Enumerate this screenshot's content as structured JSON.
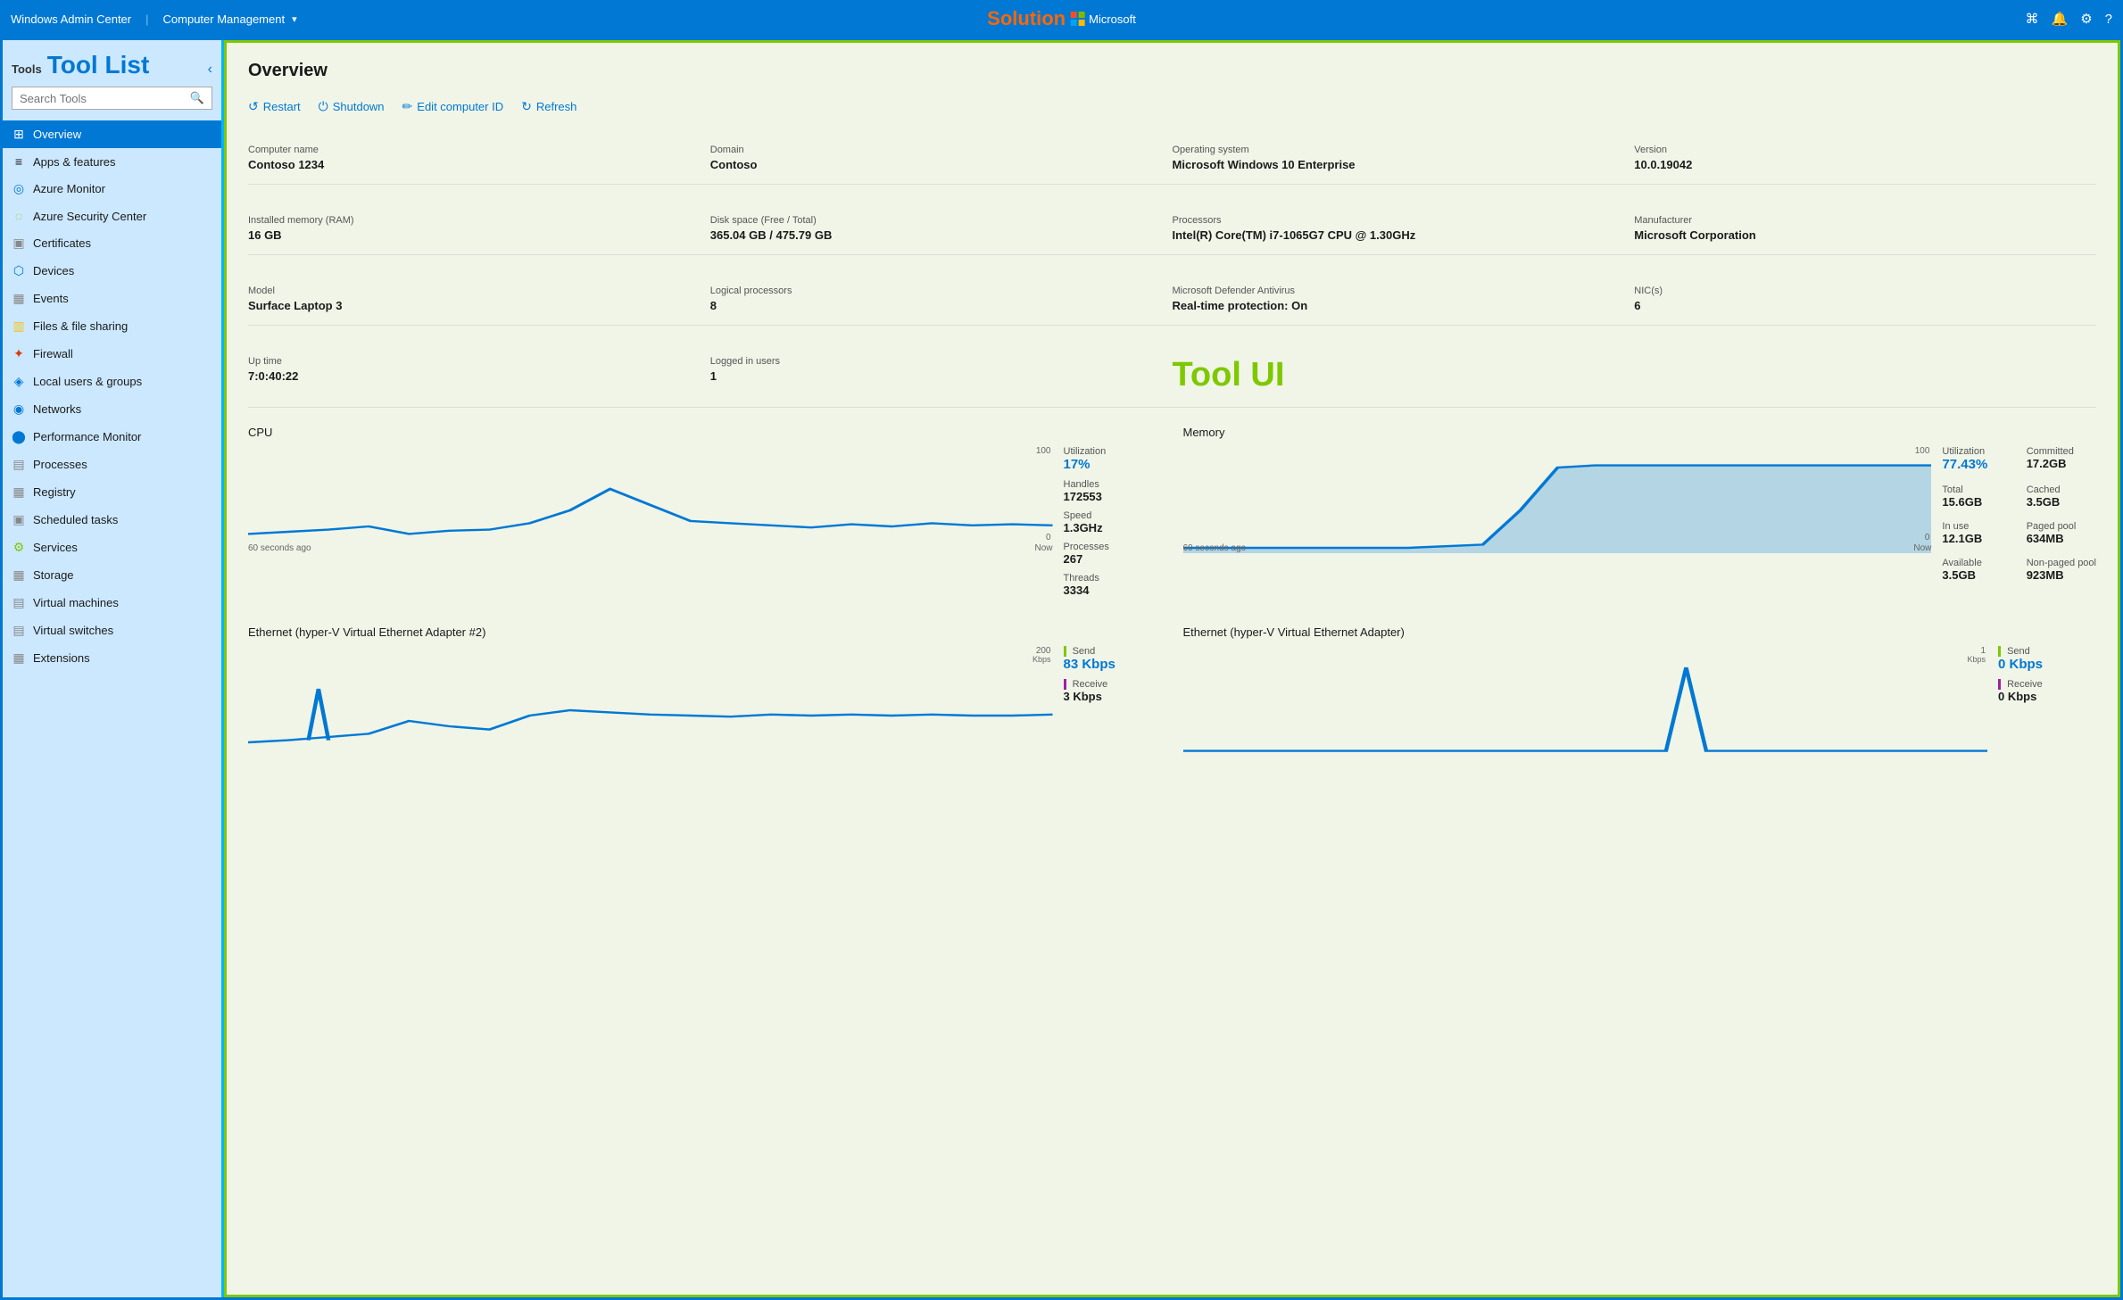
{
  "topbar": {
    "app_title": "Windows Admin Center",
    "context": "Computer Management",
    "solution_label": "Solution",
    "microsoft_label": "Microsoft",
    "icons": [
      "terminal-icon",
      "bell-icon",
      "gear-icon",
      "help-icon"
    ]
  },
  "sidebar": {
    "tools_small": "Tools",
    "title": "Tool List",
    "collapse_icon": "‹",
    "search_placeholder": "Search Tools",
    "items": [
      {
        "id": "overview",
        "label": "Overview",
        "icon": "⊞",
        "active": true
      },
      {
        "id": "apps",
        "label": "Apps & features",
        "icon": "≡"
      },
      {
        "id": "azure-monitor",
        "label": "Azure Monitor",
        "icon": "◎"
      },
      {
        "id": "azure-security",
        "label": "Azure Security Center",
        "icon": "○"
      },
      {
        "id": "certificates",
        "label": "Certificates",
        "icon": "▣"
      },
      {
        "id": "devices",
        "label": "Devices",
        "icon": "⬡"
      },
      {
        "id": "events",
        "label": "Events",
        "icon": "▦"
      },
      {
        "id": "files",
        "label": "Files & file sharing",
        "icon": "▥"
      },
      {
        "id": "firewall",
        "label": "Firewall",
        "icon": "✦"
      },
      {
        "id": "local-users",
        "label": "Local users & groups",
        "icon": "◈"
      },
      {
        "id": "networks",
        "label": "Networks",
        "icon": "◉"
      },
      {
        "id": "perf-monitor",
        "label": "Performance Monitor",
        "icon": "⬤"
      },
      {
        "id": "processes",
        "label": "Processes",
        "icon": "▤"
      },
      {
        "id": "registry",
        "label": "Registry",
        "icon": "▦"
      },
      {
        "id": "scheduled",
        "label": "Scheduled tasks",
        "icon": "▣"
      },
      {
        "id": "services",
        "label": "Services",
        "icon": "⚙"
      },
      {
        "id": "storage",
        "label": "Storage",
        "icon": "▦"
      },
      {
        "id": "vm",
        "label": "Virtual machines",
        "icon": "▤"
      },
      {
        "id": "vswitches",
        "label": "Virtual switches",
        "icon": "▤"
      },
      {
        "id": "extensions",
        "label": "Extensions",
        "icon": "▦"
      }
    ]
  },
  "overview": {
    "title": "Overview",
    "toolbar": {
      "restart": "Restart",
      "shutdown": "Shutdown",
      "edit_id": "Edit computer ID",
      "refresh": "Refresh"
    },
    "tool_ui_label": "Tool UI",
    "info": {
      "computer_name_label": "Computer name",
      "computer_name": "Contoso 1234",
      "domain_label": "Domain",
      "domain": "Contoso",
      "os_label": "Operating system",
      "os": "Microsoft Windows 10 Enterprise",
      "version_label": "Version",
      "version": "10.0.19042",
      "ram_label": "Installed memory (RAM)",
      "ram": "16 GB",
      "disk_label": "Disk space (Free / Total)",
      "disk": "365.04 GB / 475.79 GB",
      "processors_label": "Processors",
      "processors": "Intel(R) Core(TM) i7-1065G7 CPU @ 1.30GHz",
      "manufacturer_label": "Manufacturer",
      "manufacturer": "Microsoft Corporation",
      "model_label": "Model",
      "model": "Surface Laptop 3",
      "logical_proc_label": "Logical processors",
      "logical_proc": "8",
      "defender_label": "Microsoft Defender Antivirus",
      "defender": "Real-time protection: On",
      "nics_label": "NIC(s)",
      "nics": "6",
      "uptime_label": "Up time",
      "uptime": "7:0:40:22",
      "logged_label": "Logged in users",
      "logged": "1"
    },
    "cpu": {
      "title": "CPU",
      "axis_top": "100",
      "axis_bottom": "0",
      "label_left": "60 seconds ago",
      "label_right": "Now",
      "utilization_label": "Utilization",
      "utilization": "17%",
      "handles_label": "Handles",
      "handles": "172553",
      "speed_label": "Speed",
      "speed": "1.3GHz",
      "processes_label": "Processes",
      "processes": "267",
      "threads_label": "Threads",
      "threads": "3334"
    },
    "memory": {
      "title": "Memory",
      "axis_top": "100",
      "axis_bottom": "0",
      "label_left": "60 seconds ago",
      "label_right": "Now",
      "utilization_label": "Utilization",
      "utilization": "77.43%",
      "committed_label": "Committed",
      "committed": "17.2GB",
      "total_label": "Total",
      "total": "15.6GB",
      "cached_label": "Cached",
      "cached": "3.5GB",
      "inuse_label": "In use",
      "inuse": "12.1GB",
      "paged_label": "Paged pool",
      "paged": "634MB",
      "available_label": "Available",
      "available": "3.5GB",
      "nonpaged_label": "Non-paged pool",
      "nonpaged": "923MB"
    },
    "eth1": {
      "title": "Ethernet (hyper-V Virtual Ethernet Adapter #2)",
      "axis_top": "200",
      "axis_unit": "Kbps",
      "label_left": "",
      "label_right": "",
      "send_label": "Send",
      "send": "83 Kbps",
      "receive_label": "Receive",
      "receive": "3 Kbps"
    },
    "eth2": {
      "title": "Ethernet (hyper-V Virtual Ethernet Adapter)",
      "axis_top": "1",
      "axis_unit": "Kbps",
      "label_left": "",
      "label_right": "",
      "send_label": "Send",
      "send": "0 Kbps",
      "receive_label": "Receive",
      "receive": "0 Kbps"
    }
  }
}
